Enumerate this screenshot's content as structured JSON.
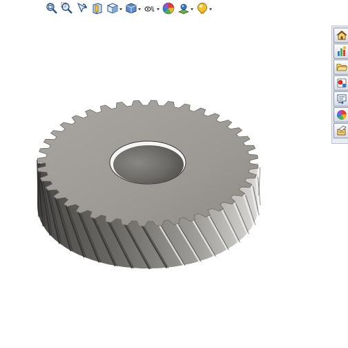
{
  "heads_up_toolbar": {
    "buttons": [
      {
        "icon": "zoom-to-fit-icon"
      },
      {
        "icon": "zoom-to-area-icon"
      },
      {
        "icon": "previous-view-icon"
      },
      {
        "icon": "section-view-icon"
      },
      {
        "icon": "view-orientation-icon",
        "dropdown": true
      },
      {
        "icon": "display-style-icon",
        "dropdown": true
      },
      {
        "icon": "hide-show-items-icon",
        "dropdown": true
      },
      {
        "icon": "edit-appearance-icon"
      },
      {
        "icon": "apply-scene-icon",
        "dropdown": true
      },
      {
        "icon": "view-settings-icon",
        "dropdown": true
      }
    ]
  },
  "task_pane": {
    "tabs": [
      {
        "icon": "home-icon"
      },
      {
        "icon": "design-library-icon"
      },
      {
        "icon": "file-explorer-icon"
      },
      {
        "icon": "view-palette-icon"
      },
      {
        "icon": "appearances-scenes-icon"
      },
      {
        "icon": "custom-properties-icon"
      },
      {
        "icon": "forum-icon"
      }
    ]
  },
  "model": {
    "type": "helical-gear",
    "colors": {
      "face": "#9e9b96",
      "flank": "#5c5a57",
      "bore": "#6e6c69",
      "highlight": "#ffffff"
    }
  }
}
